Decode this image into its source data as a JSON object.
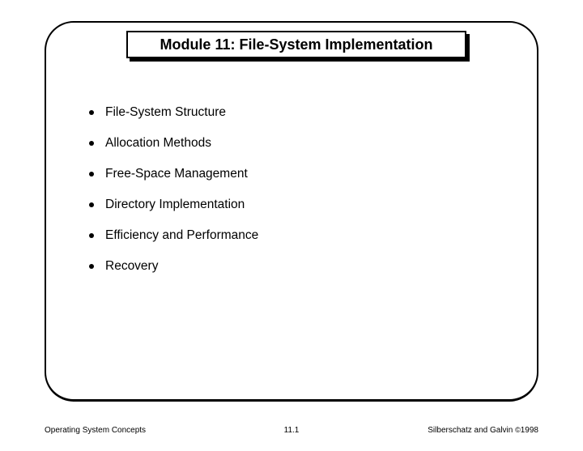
{
  "title": "Module 11: File-System Implementation",
  "bullets": [
    "File-System Structure",
    "Allocation Methods",
    "Free-Space Management",
    "Directory Implementation",
    "Efficiency and Performance",
    "Recovery"
  ],
  "footer": {
    "left": "Operating System Concepts",
    "center": "11.1",
    "right_authors": "Silberschatz and Galvin ",
    "right_copy": "©",
    "right_year": "1998"
  }
}
